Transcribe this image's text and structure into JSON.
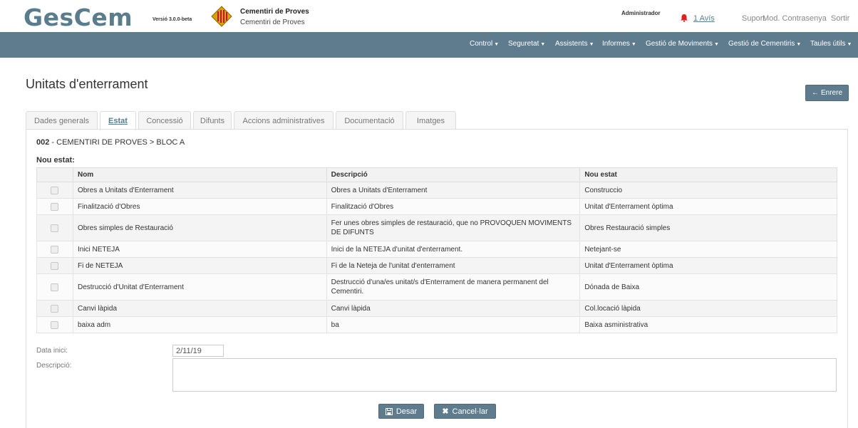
{
  "header": {
    "logo": "GesCem",
    "version": "Versió 3.0.0-beta",
    "cemetery_name": "Cementiri de Proves",
    "cemetery_sub": "Cementiri de Proves",
    "user": "Administrador",
    "notice": "1 Avís",
    "support": "Suport",
    "change_password": "Mod. Contrasenya",
    "logout": "Sortir"
  },
  "nav": [
    "Control",
    "Seguretat",
    "Assistents",
    "Informes",
    "Gestió de Moviments",
    "Gestió de Cementiris",
    "Taules útils"
  ],
  "page": {
    "title": "Unitats d'enterrament",
    "back_button": "Enrere"
  },
  "tabs": [
    "Dades generals",
    "Estat",
    "Concessió",
    "Difunts",
    "Accions administratives",
    "Documentació",
    "Imatges"
  ],
  "active_tab": "Estat",
  "breadcrumb": {
    "code": "002",
    "path": " - CEMENTIRI DE PROVES > BLOC A"
  },
  "section_label": "Nou estat:",
  "table": {
    "columns": [
      "Nom",
      "Descripció",
      "Nou estat"
    ],
    "rows": [
      {
        "nom": "Obres a Unitats d'Enterrament",
        "descripcio": "Obres a Unitats d'Enterrament",
        "nou_estat": "Construccio"
      },
      {
        "nom": "Finalització d'Obres",
        "descripcio": "Finalització d'Obres",
        "nou_estat": "Unitat d'Enterrament òptima"
      },
      {
        "nom": "Obres simples de Restauració",
        "descripcio": "Fer unes obres simples de restauració, que no PROVOQUEN MOVIMENTS DE DIFUNTS",
        "nou_estat": "Obres Restauració simples"
      },
      {
        "nom": "Inici NETEJA",
        "descripcio": "Inici de la NETEJA d'unitat d'enterrament.",
        "nou_estat": "Netejant-se"
      },
      {
        "nom": "Fi de NETEJA",
        "descripcio": "Fi de la Neteja de l'unitat d'enterrament",
        "nou_estat": "Unitat d'Enterrament òptima"
      },
      {
        "nom": "Destrucció d'Unitat d'Enterrament",
        "descripcio": "Destrucció d'una/es unitat/s d'Enterrament de manera permanent del Cementiri.",
        "nou_estat": "Dónada de Baixa"
      },
      {
        "nom": "Canvi làpida",
        "descripcio": "Canvi làpida",
        "nou_estat": "Col.locació làpida"
      },
      {
        "nom": "baixa adm",
        "descripcio": "ba",
        "nou_estat": "Baixa asministrativa"
      }
    ]
  },
  "form": {
    "start_date_label": "Data inici:",
    "start_date_value": "2/11/19",
    "description_label": "Descripció:",
    "description_value": ""
  },
  "buttons": {
    "save": "Desar",
    "cancel": "Cancel·lar"
  },
  "colors": {
    "brand": "#5f7c8e",
    "logo": "#5a7d8e",
    "bell": "#e02020"
  }
}
